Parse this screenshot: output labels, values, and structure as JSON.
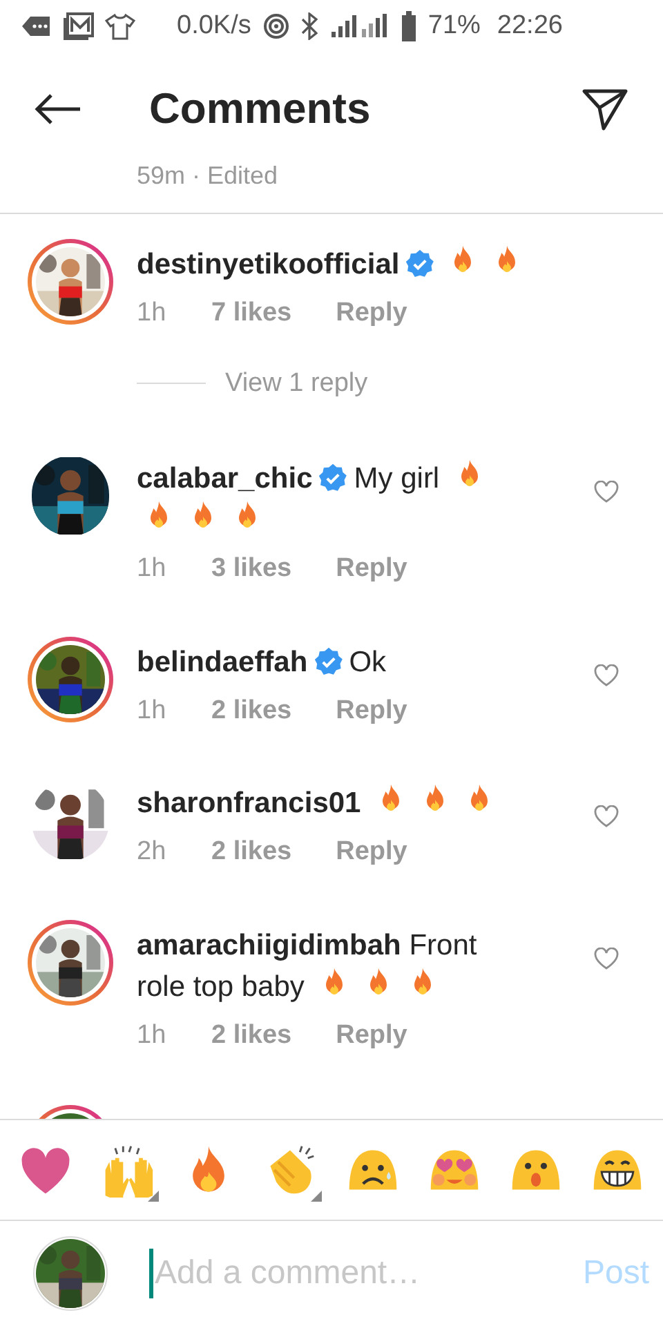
{
  "status_bar": {
    "speed": "0.0K/s",
    "battery": "71%",
    "time": "22:26"
  },
  "header": {
    "title": "Comments"
  },
  "previous_meta": "59m · Edited",
  "comments": [
    {
      "username": "destinyetikoofficial",
      "verified": true,
      "reactions": [
        {
          "kind": "fire"
        },
        {
          "kind": "fire"
        }
      ],
      "time": "1h",
      "likes": "7 likes",
      "reply": "Reply",
      "story_ring": true,
      "like_button": false,
      "replies_link": "View 1 reply"
    },
    {
      "username": "calabar_chic",
      "verified": true,
      "text": "My girl",
      "reactions": [
        {
          "kind": "fire"
        },
        {
          "kind": "fire"
        },
        {
          "kind": "fire"
        },
        {
          "kind": "fire"
        }
      ],
      "time": "1h",
      "likes": "3 likes",
      "reply": "Reply",
      "story_ring": false,
      "like_button": true
    },
    {
      "username": "belindaeffah",
      "verified": true,
      "text": "Ok",
      "time": "1h",
      "likes": "2 likes",
      "reply": "Reply",
      "story_ring": true,
      "like_button": true
    },
    {
      "username": "sharonfrancis01",
      "verified": false,
      "reactions": [
        {
          "kind": "fire"
        },
        {
          "kind": "fire"
        },
        {
          "kind": "fire"
        }
      ],
      "time": "2h",
      "likes": "2 likes",
      "reply": "Reply",
      "story_ring": false,
      "like_button": true
    },
    {
      "username": "amarachiigidimbah",
      "verified": false,
      "text": "Front role top baby",
      "reactions": [
        {
          "kind": "fire"
        },
        {
          "kind": "fire"
        },
        {
          "kind": "fire"
        }
      ],
      "time": "1h",
      "likes": "2 likes",
      "reply": "Reply",
      "story_ring": true,
      "like_button": true
    }
  ],
  "partial_comment": {
    "story_ring": true
  },
  "emoji_bar": [
    {
      "kind": "heart",
      "has_variants": false
    },
    {
      "kind": "raised_hands",
      "has_variants": true
    },
    {
      "kind": "fire",
      "has_variants": false
    },
    {
      "kind": "clap",
      "has_variants": true
    },
    {
      "kind": "sad",
      "has_variants": false
    },
    {
      "kind": "heart_eyes",
      "has_variants": false
    },
    {
      "kind": "surprised",
      "has_variants": false
    },
    {
      "kind": "laugh",
      "has_variants": false
    }
  ],
  "composer": {
    "placeholder": "Add a comment…",
    "post": "Post",
    "post_disabled": true
  }
}
